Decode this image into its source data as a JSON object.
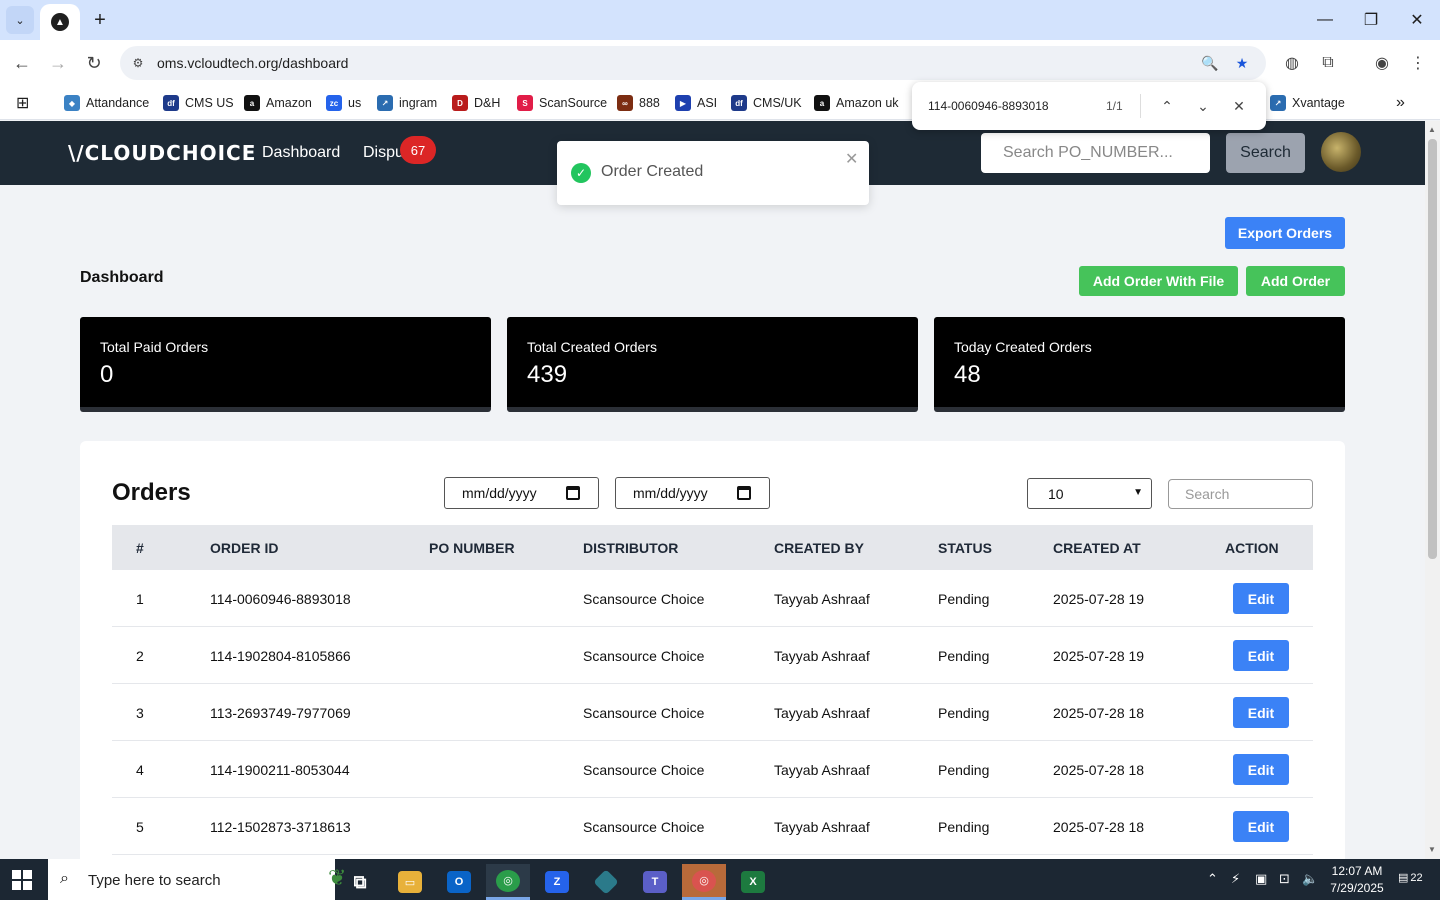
{
  "browser": {
    "url": "oms.vcloudtech.org/dashboard",
    "bookmarks": [
      {
        "label": "Attandance",
        "icon": "attendance-icon",
        "color": "#3b82c4"
      },
      {
        "label": "CMS US",
        "icon": "df-icon",
        "color": "#1e3a8a"
      },
      {
        "label": "Amazon",
        "icon": "amazon-icon",
        "color": "#111111"
      },
      {
        "label": "us",
        "icon": "zc-icon",
        "color": "#2563eb"
      },
      {
        "label": "ingram",
        "icon": "ingram-icon",
        "color": "#2b6cb0"
      },
      {
        "label": "D&H",
        "icon": "dh-icon",
        "color": "#b91c1c"
      },
      {
        "label": "ScanSource",
        "icon": "scansource-icon",
        "color": "#e11d48"
      },
      {
        "label": "888",
        "icon": "888-icon",
        "color": "#7c2d12"
      },
      {
        "label": "ASI",
        "icon": "asi-icon",
        "color": "#1e40af"
      },
      {
        "label": "CMS/UK",
        "icon": "df-icon",
        "color": "#1e3a8a"
      },
      {
        "label": "Amazon uk",
        "icon": "amazon-icon",
        "color": "#111111"
      },
      {
        "label": "Xvantage",
        "icon": "xvantage-icon",
        "color": "#2b6cb0"
      }
    ],
    "find": {
      "query": "114-0060946-8893018",
      "count": "1/1"
    }
  },
  "navbar": {
    "logo": "\\/CLOUDCHOICE",
    "links": {
      "dashboard": "Dashboard",
      "disputes": "Dispu"
    },
    "badge": "67",
    "search_placeholder": "Search PO_NUMBER...",
    "search_button": "Search"
  },
  "toast": {
    "message": "Order Created"
  },
  "actions": {
    "export": "Export Orders",
    "add_with_file": "Add Order With File",
    "add": "Add Order"
  },
  "page_title": "Dashboard",
  "stats": [
    {
      "label": "Total Paid Orders",
      "value": "0"
    },
    {
      "label": "Total Created Orders",
      "value": "439"
    },
    {
      "label": "Today Created Orders",
      "value": "48"
    }
  ],
  "orders": {
    "title": "Orders",
    "date_from": "mm/dd/yyyy",
    "date_to": "mm/dd/yyyy",
    "page_size": "10",
    "search_placeholder": "Search",
    "columns": [
      "#",
      "ORDER ID",
      "PO NUMBER",
      "DISTRIBUTOR",
      "CREATED BY",
      "STATUS",
      "CREATED AT",
      "ACTION"
    ],
    "edit_label": "Edit",
    "rows": [
      {
        "n": "1",
        "order_id": "114-0060946-8893018",
        "po": "",
        "distributor": "Scansource Choice",
        "created_by": "Tayyab Ashraaf",
        "status": "Pending",
        "created_at": "2025-07-28 19"
      },
      {
        "n": "2",
        "order_id": "114-1902804-8105866",
        "po": "",
        "distributor": "Scansource Choice",
        "created_by": "Tayyab Ashraaf",
        "status": "Pending",
        "created_at": "2025-07-28 19"
      },
      {
        "n": "3",
        "order_id": "113-2693749-7977069",
        "po": "",
        "distributor": "Scansource Choice",
        "created_by": "Tayyab Ashraaf",
        "status": "Pending",
        "created_at": "2025-07-28 18"
      },
      {
        "n": "4",
        "order_id": "114-1900211-8053044",
        "po": "",
        "distributor": "Scansource Choice",
        "created_by": "Tayyab Ashraaf",
        "status": "Pending",
        "created_at": "2025-07-28 18"
      },
      {
        "n": "5",
        "order_id": "112-1502873-3718613",
        "po": "",
        "distributor": "Scansource Choice",
        "created_by": "Tayyab Ashraaf",
        "status": "Pending",
        "created_at": "2025-07-28 18"
      }
    ]
  },
  "taskbar": {
    "search_text": "Type here to search",
    "time": "12:07 AM",
    "date": "7/29/2025",
    "notifications": "22"
  },
  "colors": {
    "navbar": "#1e2a35",
    "primary": "#3b82f6",
    "success": "#46c35a",
    "badge": "#dc2626"
  }
}
